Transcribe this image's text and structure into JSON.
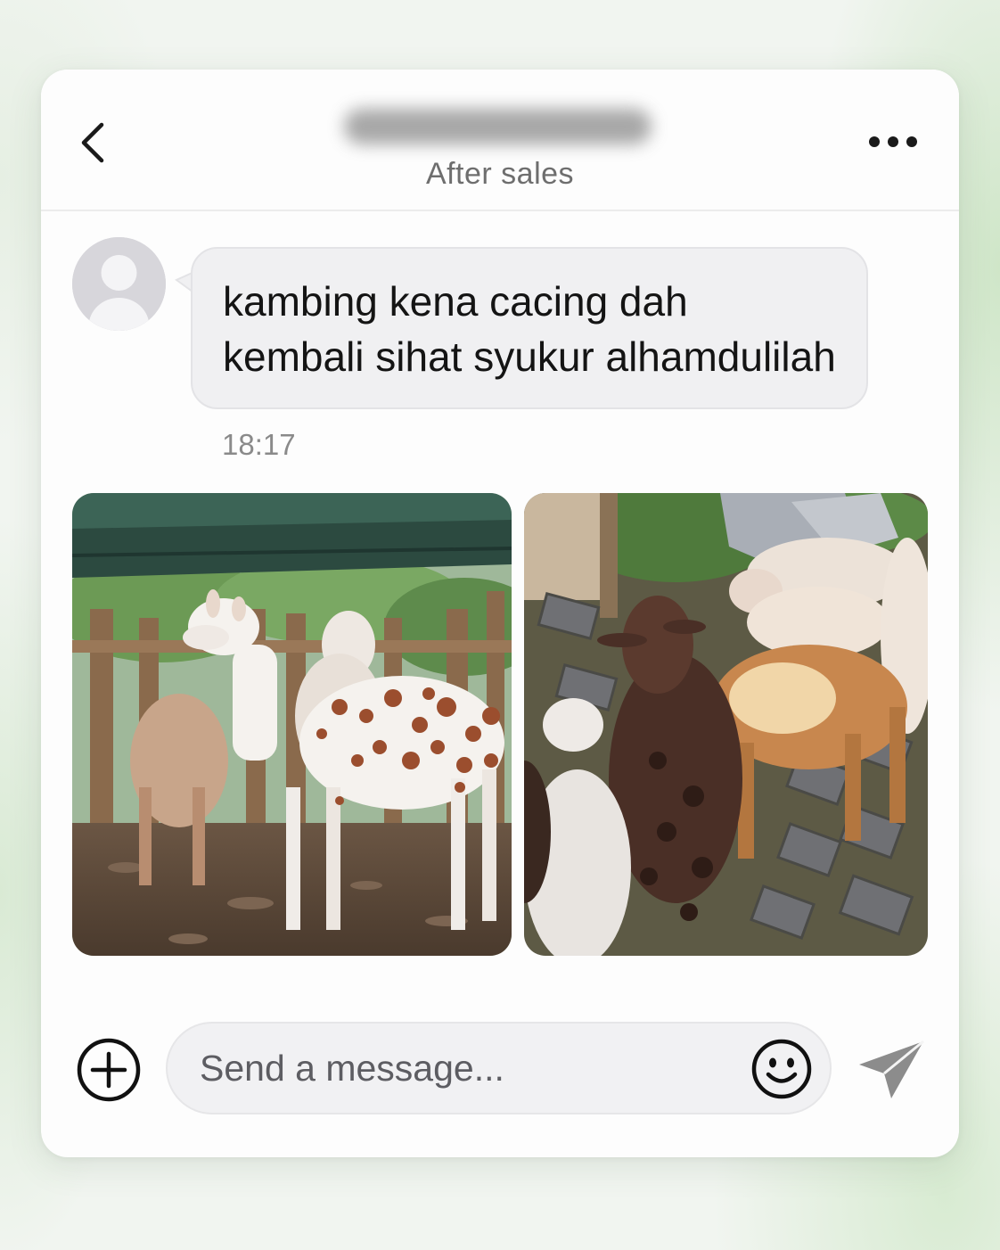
{
  "header": {
    "title_redacted": "",
    "subtitle": "After sales",
    "back_icon": "chevron-left-icon",
    "more_icon": "more-horizontal-icon"
  },
  "message": {
    "sender_avatar_icon": "default-user-avatar",
    "text_line1": "kambing kena cacing dah",
    "text_line2": "kembali sihat syukur alhamdulilah",
    "timestamp": "18:17"
  },
  "photos": [
    {
      "description_icon": "goat-pen-photo"
    },
    {
      "description_icon": "goats-grazing-photo"
    }
  ],
  "composer": {
    "add_icon": "plus-circle-icon",
    "placeholder": "Send a message...",
    "emoji_icon": "smiley-icon",
    "send_icon": "send-icon"
  },
  "colors": {
    "background": "#f1f5f0",
    "card": "#fdfdfd",
    "bubble": "#f0f0f2",
    "text": "#141414",
    "muted": "#8a8a8a",
    "send_icon": "#8c8c8c"
  }
}
